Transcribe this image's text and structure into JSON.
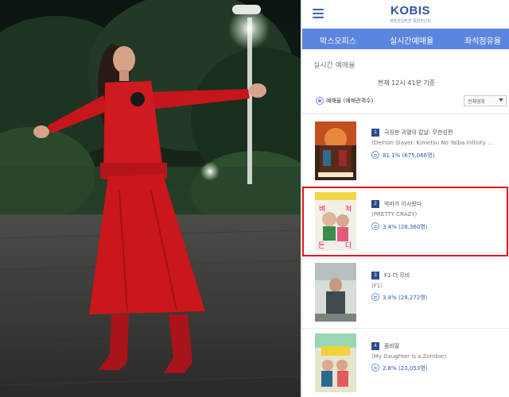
{
  "photo": {
    "description_icon": "photo-icon"
  },
  "header": {
    "menu_icon": "hamburger-icon",
    "logo_text": "KOBIS",
    "logo_subtitle": "영화관입장권 통합전산망"
  },
  "nav": {
    "tabs": [
      {
        "label": "박스오피스"
      },
      {
        "label": "실시간예매율"
      },
      {
        "label": "좌석점유율"
      }
    ]
  },
  "page": {
    "section_title": "실시간 예매율",
    "timestamp": "현재  12시 41분  기준",
    "filter_label": "예매율 (예매관객수)",
    "select_value": "전체영화"
  },
  "movies": [
    {
      "rank": "1",
      "title_ko": "극장판 귀멸의 칼날: 무한성편",
      "title_en": "(Demon Slayer: Kimetsu No Yaiba Infinity …",
      "stat": "81.1% (675,066명)"
    },
    {
      "rank": "2",
      "title_ko": "악마가 이사왔다",
      "title_en": "(PRETTY CRAZY)",
      "stat": "3.4% (28,360명)",
      "poster_text": "벼 쳐 든 다"
    },
    {
      "rank": "3",
      "title_ko": "F1 더 무비",
      "title_en": "(F1)",
      "stat": "3.4% (28,272명)"
    },
    {
      "rank": "4",
      "title_ko": "좀비딸",
      "title_en": "(My Daughter is a Zombie)",
      "stat": "2.8% (23,053명)"
    }
  ],
  "colors": {
    "nav_bg": "#5b86df",
    "logo": "#2f57a8",
    "rank_bg": "#2c4b8a",
    "highlight": "#e3161b"
  }
}
